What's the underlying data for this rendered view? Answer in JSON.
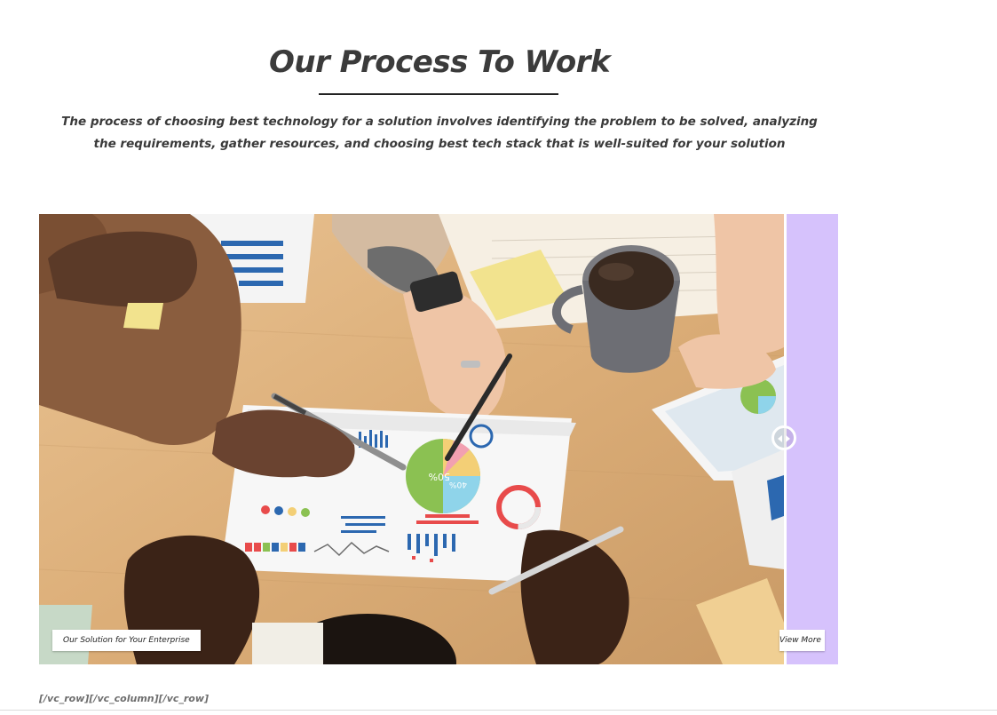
{
  "section": {
    "title": "Our Process To Work",
    "description": "The process of choosing best technology for a solution involves identifying the problem to be solved, analyzing the requirements, gather resources, and choosing best tech stack that is well-suited for your solution"
  },
  "comparison": {
    "before_label": "Our Solution for Your Enterprise",
    "after_label": "View More",
    "handle_icon": "arrows-left-right-icon",
    "after_color": "#d6c2fc",
    "slider_position": 0.93
  },
  "photo": {
    "chart_percent_1": "50%",
    "chart_percent_2": "40%"
  },
  "footer": {
    "shortcode_text": "[/vc_row][/vc_column][/vc_row]"
  }
}
